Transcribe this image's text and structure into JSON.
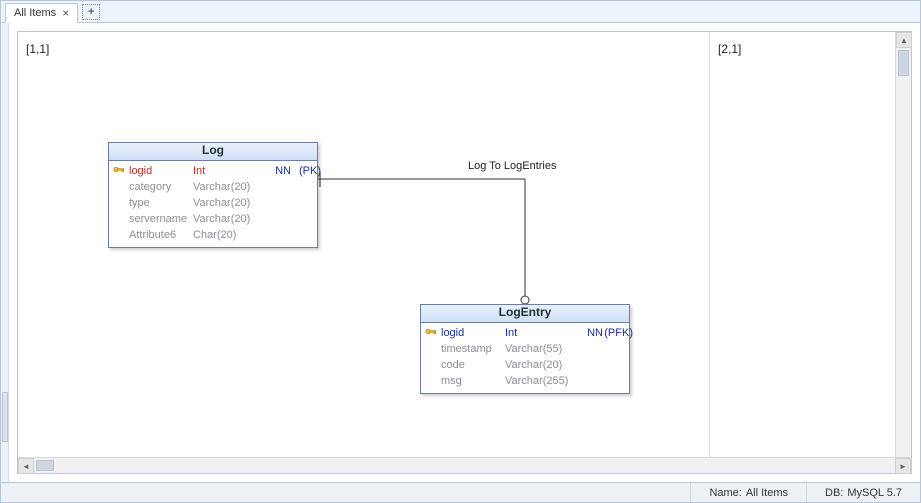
{
  "tabs": {
    "active_label": "All Items"
  },
  "panes": {
    "left_label": "[1,1]",
    "right_label": "[2,1]"
  },
  "relationship": {
    "label": "Log To LogEntries"
  },
  "entity_log": {
    "title": "Log",
    "rows": [
      {
        "name": "logid",
        "type": "Int",
        "nn": "NN",
        "key": "(PK)",
        "kind": "pk"
      },
      {
        "name": "category",
        "type": "Varchar(20)",
        "nn": "",
        "key": "",
        "kind": ""
      },
      {
        "name": "type",
        "type": "Varchar(20)",
        "nn": "",
        "key": "",
        "kind": ""
      },
      {
        "name": "servername",
        "type": "Varchar(20)",
        "nn": "",
        "key": "",
        "kind": ""
      },
      {
        "name": "Attribute6",
        "type": "Char(20)",
        "nn": "",
        "key": "",
        "kind": ""
      }
    ]
  },
  "entity_logentry": {
    "title": "LogEntry",
    "rows": [
      {
        "name": "logid",
        "type": "Int",
        "nn": "NN",
        "key": "(PFK)",
        "kind": "fk"
      },
      {
        "name": "timestamp",
        "type": "Varchar(55)",
        "nn": "",
        "key": "",
        "kind": ""
      },
      {
        "name": "code",
        "type": "Varchar(20)",
        "nn": "",
        "key": "",
        "kind": ""
      },
      {
        "name": "msg",
        "type": "Varchar(255)",
        "nn": "",
        "key": "",
        "kind": ""
      }
    ]
  },
  "status": {
    "name_label": "Name:",
    "name_value": "All Items",
    "db_label": "DB:",
    "db_value": "MySQL 5.7"
  }
}
